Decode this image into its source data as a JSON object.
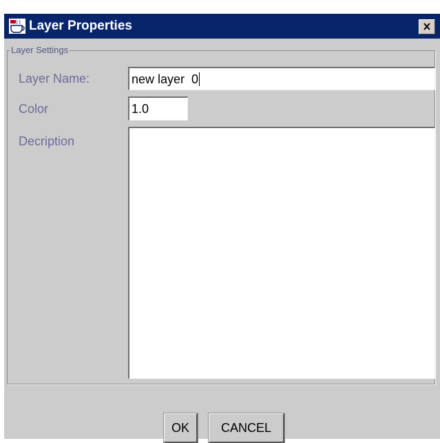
{
  "window": {
    "title": "Layer Properties",
    "close_label": "Close"
  },
  "layer_settings": {
    "legend": "Layer Settings",
    "layer_name_label": "Layer Name:",
    "layer_name_value": "new layer  0",
    "color_label": "Color",
    "color_value": "1.0",
    "description_label": "Decription",
    "description_value": ""
  },
  "buttons": {
    "ok_label": "OK",
    "cancel_label": "CANCEL"
  },
  "icons": {
    "app": "java-cup-icon",
    "close": "close-x-icon"
  },
  "colors": {
    "titlebar": "#08246b",
    "dialog_background": "#cccccc",
    "label_text": "#6b6b9b"
  }
}
